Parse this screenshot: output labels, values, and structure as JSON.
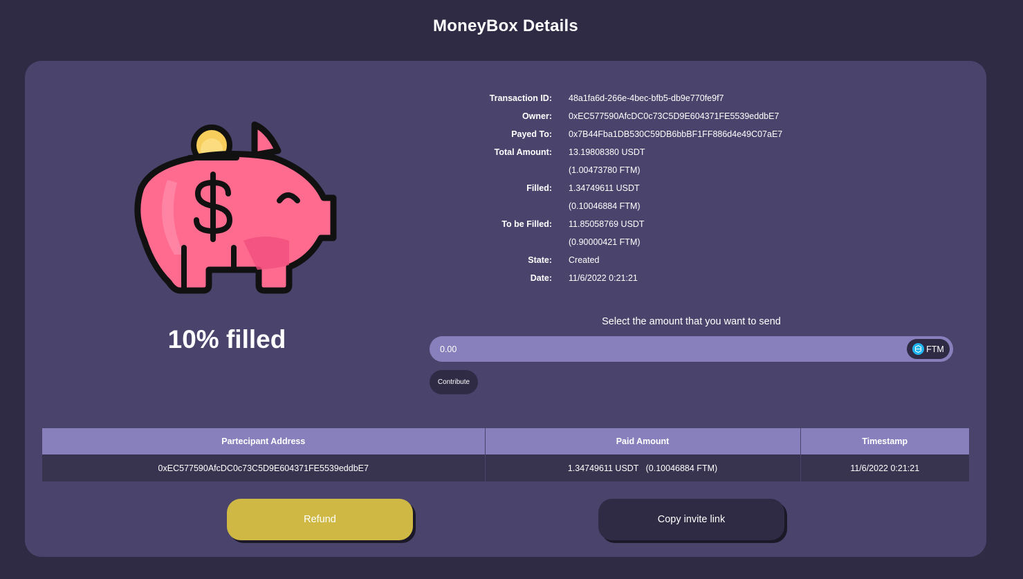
{
  "header": {
    "title": "MoneyBox Details"
  },
  "progress": {
    "percent": 10,
    "label": "10% filled"
  },
  "details": [
    {
      "label": "Transaction ID:",
      "value": "48a1fa6d-266e-4bec-bfb5-db9e770fe9f7"
    },
    {
      "label": "Owner:",
      "value": "0xEC577590AfcDC0c73C5D9E604371FE5539eddbE7"
    },
    {
      "label": "Payed To:",
      "value": "0x7B44Fba1DB530C59DB6bbBF1FF886d4e49C07aE7"
    },
    {
      "label": "Total Amount:",
      "value": "13.19808380 USDT"
    },
    {
      "label": "",
      "value": "(1.00473780 FTM)"
    },
    {
      "label": "Filled:",
      "value": "1.34749611 USDT"
    },
    {
      "label": "",
      "value": "(0.10046884 FTM)"
    },
    {
      "label": "To be Filled:",
      "value": "11.85058769 USDT"
    },
    {
      "label": "",
      "value": "(0.90000421 FTM)"
    },
    {
      "label": "State:",
      "value": "Created"
    },
    {
      "label": "Date:",
      "value": "11/6/2022 0:21:21"
    }
  ],
  "contribute": {
    "prompt": "Select the amount that you want to send",
    "amount_placeholder": "0.00",
    "currency": "FTM",
    "currency_icon": "fantom-icon",
    "button_label": "Contribute"
  },
  "table": {
    "headers": [
      "Partecipant Address",
      "Paid Amount",
      "Timestamp"
    ],
    "rows": [
      [
        "0xEC577590AfcDC0c73C5D9E604371FE5539eddbE7",
        "1.34749611 USDT   (0.10046884 FTM)",
        "11/6/2022 0:21:21"
      ]
    ]
  },
  "actions": {
    "refund_label": "Refund",
    "invite_label": "Copy invite link"
  },
  "colors": {
    "background": "#2f2b45",
    "card": "#4a446d",
    "accent": "#8880bc",
    "refund": "#cfb944",
    "pig": "#ff6a8f",
    "coin": "#f7cd5c"
  }
}
